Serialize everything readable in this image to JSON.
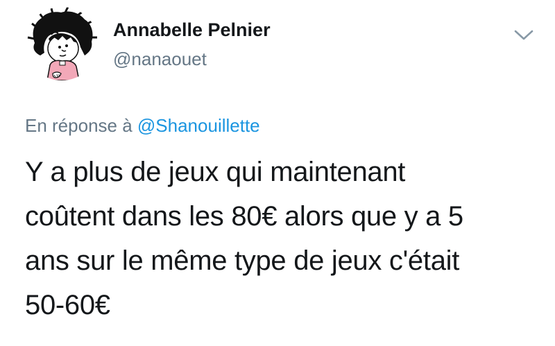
{
  "author": {
    "display_name": "Annabelle Pelnier",
    "handle": "@nanaouet",
    "avatar_icon": "mafalda-cartoon-avatar"
  },
  "menu": {
    "icon": "chevron-down-icon"
  },
  "reply": {
    "prefix": "En réponse à",
    "mention": "@Shanouillette"
  },
  "tweet": {
    "lines": [
      "Y a plus de jeux qui maintenant",
      "coûtent dans les 80€ alors que y a 5",
      "ans sur le même type de jeux c'était",
      "50-60€"
    ]
  },
  "colors": {
    "text_primary": "#14171a",
    "text_secondary": "#657786",
    "link": "#1b95e0"
  }
}
